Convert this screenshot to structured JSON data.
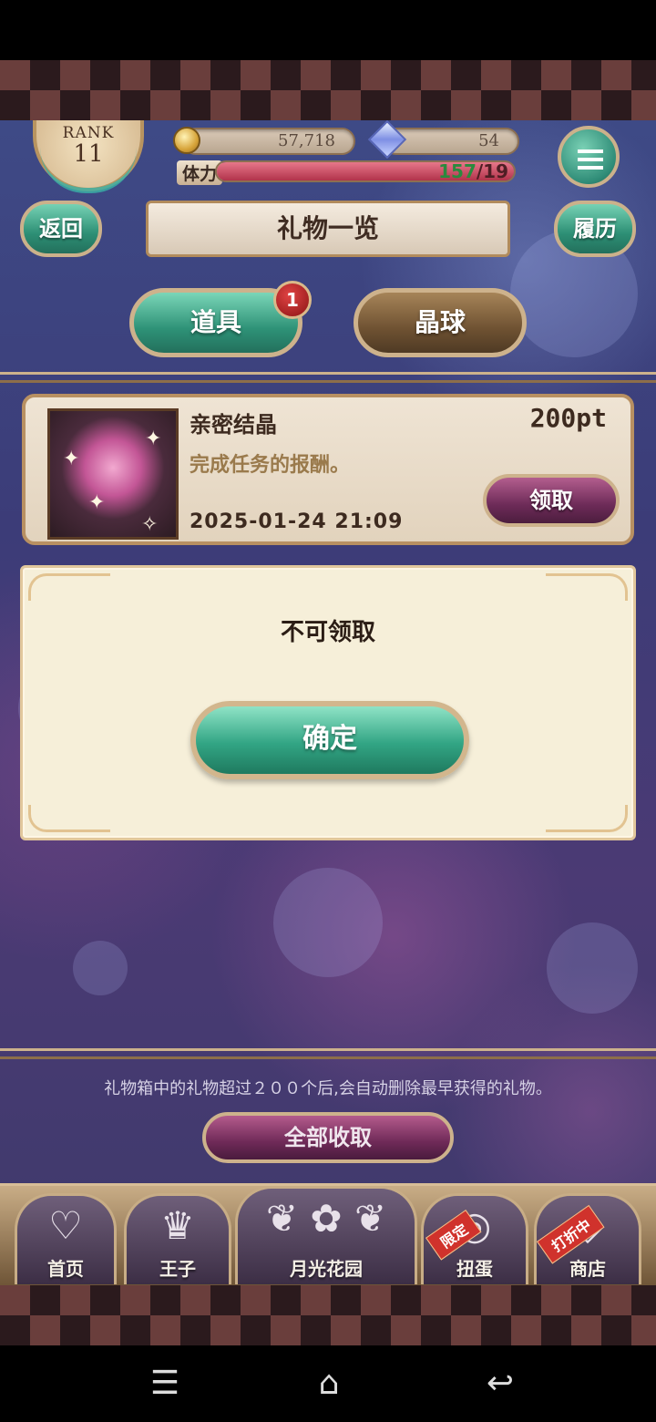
{
  "hud": {
    "rank_label": "RANK",
    "rank_value": "11",
    "coins": "57,718",
    "gems": "54",
    "stamina_label": "体力",
    "stamina_current": "157",
    "stamina_max": "/19",
    "stamina_fraction": 1.0
  },
  "header": {
    "back_label": "返回",
    "title": "礼物一览",
    "history_label": "履历"
  },
  "tabs": [
    {
      "label": "道具",
      "badge": "1",
      "active": true
    },
    {
      "label": "晶球",
      "active": false
    }
  ],
  "gift": {
    "name": "亲密结晶",
    "amount": "200pt",
    "description": "完成任务的报酬。",
    "date": "2025-01-24 21:09",
    "receive_label": "领取"
  },
  "dialog": {
    "message": "不可领取",
    "confirm_label": "确定"
  },
  "footer": {
    "notice": "礼物箱中的礼物超过２００个后,会自动删除最早获得的礼物。",
    "claim_all_label": "全部收取"
  },
  "nav": [
    {
      "label": "首页",
      "icon": "heart-icon"
    },
    {
      "label": "王子",
      "icon": "crown-icon"
    },
    {
      "label": "月光花园",
      "icon": "garden-icon"
    },
    {
      "label": "扭蛋",
      "icon": "ring-icon",
      "ribbon": "限定"
    },
    {
      "label": "商店",
      "icon": "gem-shop-icon",
      "ribbon": "打折中"
    }
  ],
  "colors": {
    "accent_green": "#2e9277",
    "accent_magenta": "#6f2a58",
    "gold_border": "#cdb28c"
  }
}
